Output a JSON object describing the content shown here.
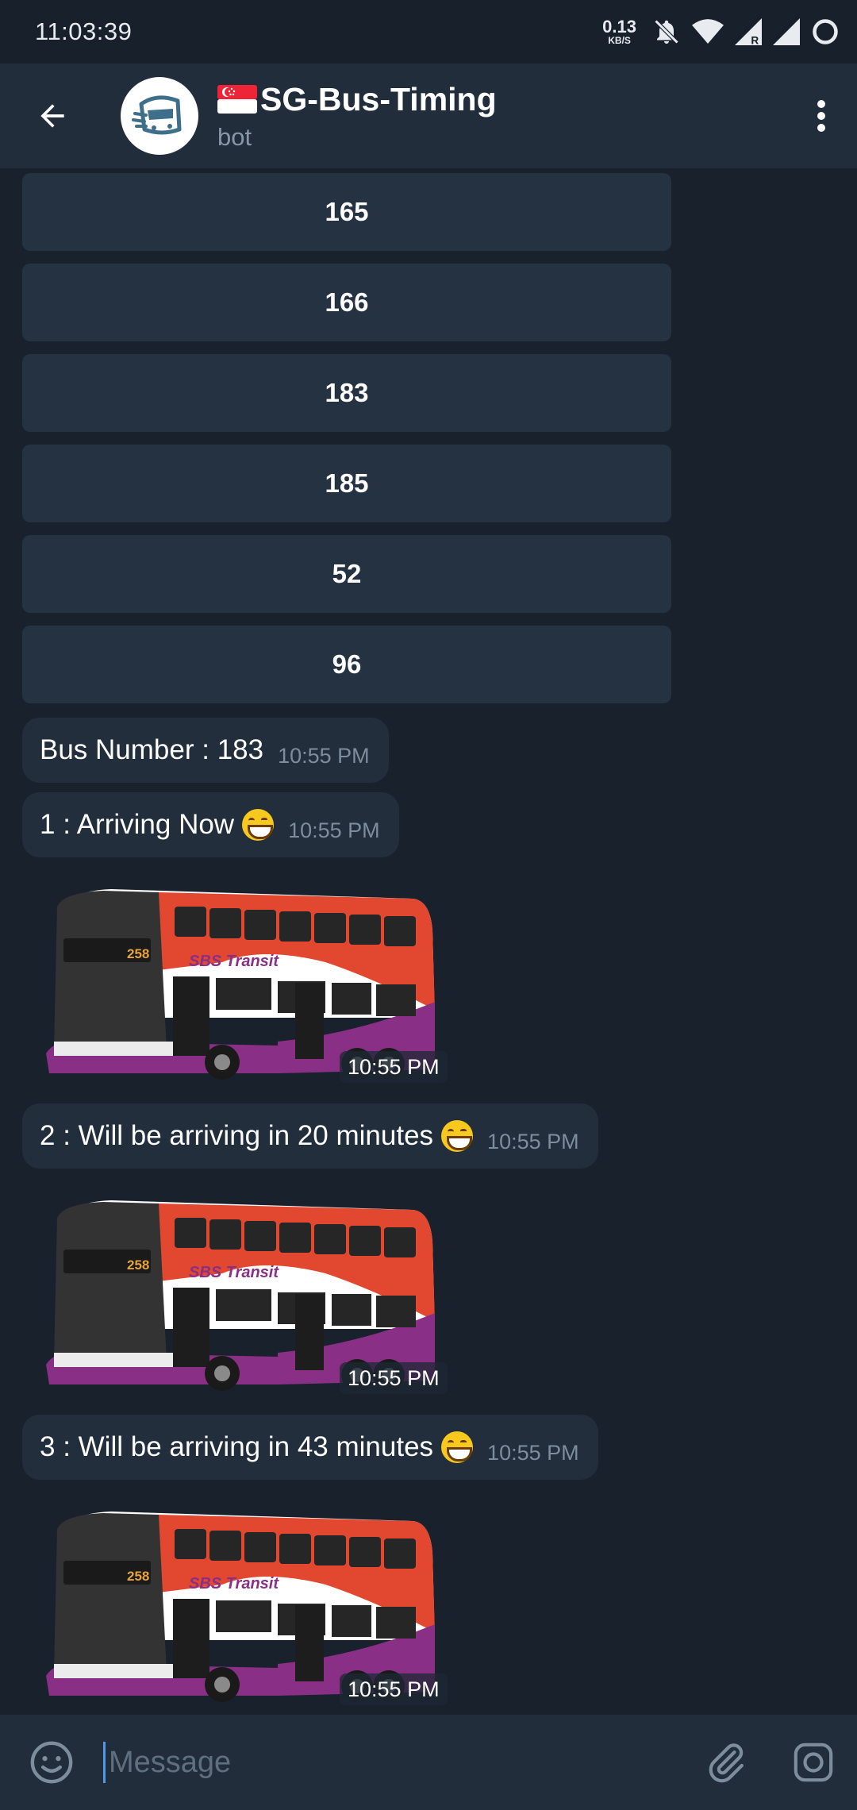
{
  "status_bar": {
    "time": "11:03:39",
    "net_speed_value": "0.13",
    "net_speed_unit": "KB/S"
  },
  "header": {
    "title": "SG-Bus-Timing",
    "subtitle": "bot"
  },
  "keyboard": {
    "buttons": [
      "165",
      "166",
      "183",
      "185",
      "52",
      "96"
    ]
  },
  "messages": [
    {
      "text": "Bus Number : 183",
      "time": "10:55 PM"
    },
    {
      "text": "1 : Arriving Now",
      "time": "10:55 PM",
      "sticker_time": "10:55 PM"
    },
    {
      "text": "2 : Will be arriving in 20 minutes",
      "time": "10:55 PM",
      "sticker_time": "10:55 PM"
    },
    {
      "text": "3 : Will be arriving in 43 minutes",
      "time": "10:55 PM",
      "sticker_time": "10:55 PM"
    }
  ],
  "sticker": {
    "operator": "SBS Transit",
    "route_display": "258"
  },
  "input": {
    "placeholder": "Message"
  },
  "colors": {
    "background": "#18212c",
    "header": "#212d3b",
    "bubble": "#222e3c",
    "keyboard_button": "#253242",
    "accent": "#4f9ae8"
  }
}
